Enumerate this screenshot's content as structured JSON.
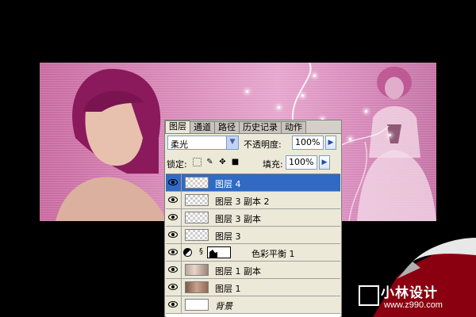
{
  "palette": {
    "tabs": [
      {
        "label": "图层",
        "active": true
      },
      {
        "label": "通道",
        "active": false
      },
      {
        "label": "路径",
        "active": false
      },
      {
        "label": "历史记录",
        "active": false
      },
      {
        "label": "动作",
        "active": false
      }
    ],
    "blend_mode": "柔光",
    "opacity_label": "不透明度:",
    "opacity_value": "100%",
    "lock_label": "锁定:",
    "fill_label": "填充:",
    "fill_value": "100%",
    "layers": [
      {
        "name": "图层 4",
        "selected": true,
        "thumb": "transparent"
      },
      {
        "name": "图层 3 副本 2",
        "selected": false,
        "thumb": "transparent"
      },
      {
        "name": "图层 3 副本",
        "selected": false,
        "thumb": "transparent"
      },
      {
        "name": "图层 3",
        "selected": false,
        "thumb": "transparent"
      },
      {
        "name": "色彩平衡 1",
        "selected": false,
        "thumb": "adjustment"
      },
      {
        "name": "图层 1 副本",
        "selected": false,
        "thumb": "photo"
      },
      {
        "name": "图层 1",
        "selected": false,
        "thumb": "photo"
      },
      {
        "name": "背景",
        "selected": false,
        "thumb": "white",
        "italic": true
      }
    ]
  },
  "watermark": {
    "brand": "小林设计",
    "url": "www.z990.com"
  },
  "colors": {
    "selection": "#316ac5",
    "panel": "#ece9d8",
    "banner_pink": "#d98cba",
    "hair": "#8a1a5c"
  }
}
